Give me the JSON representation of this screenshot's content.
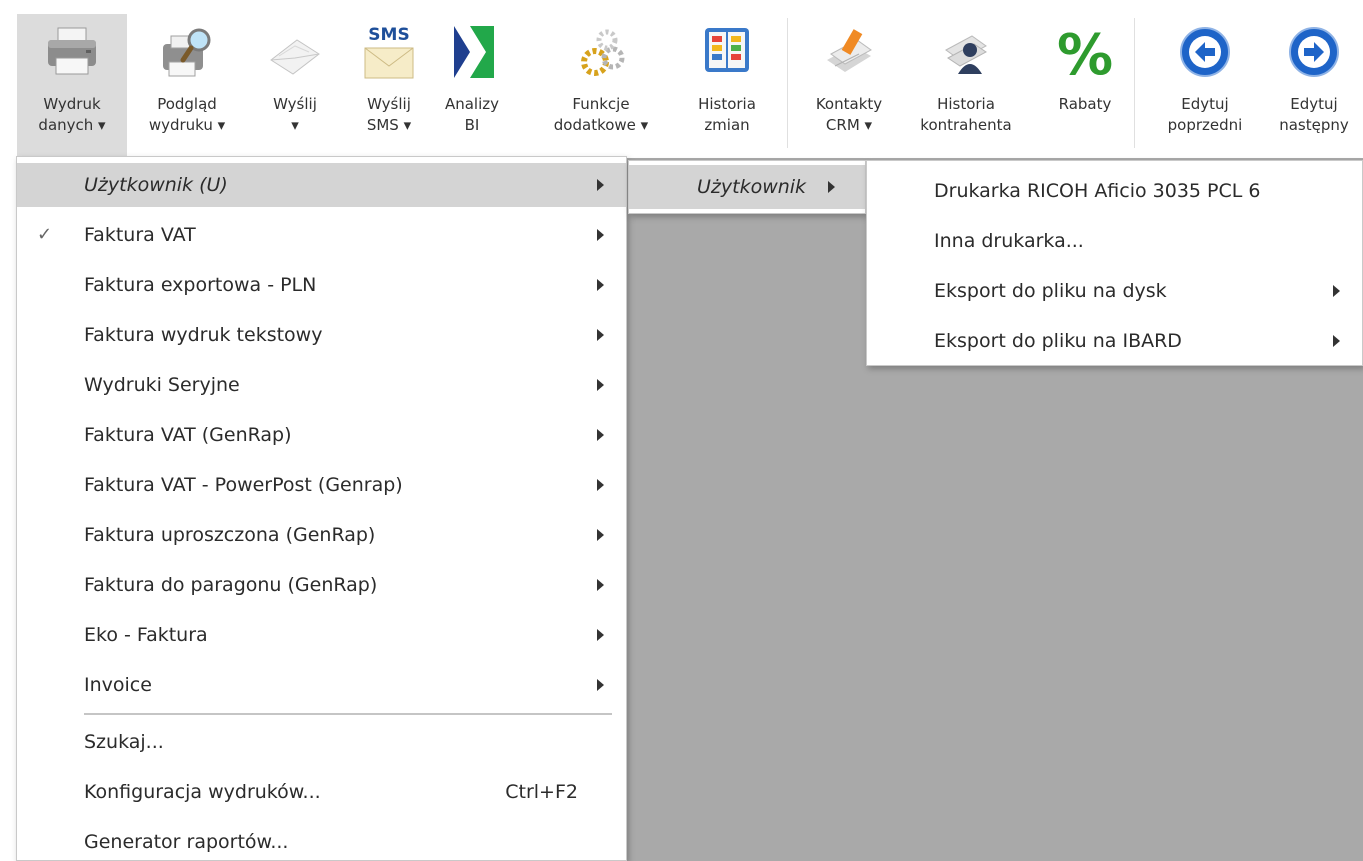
{
  "ribbon": {
    "buttons": [
      {
        "line1": "Wydruk",
        "line2": "danych ▾",
        "icon": "printer-icon"
      },
      {
        "line1": "Podgląd",
        "line2": "wydruku ▾",
        "icon": "print-preview-icon"
      },
      {
        "line1": "Wyślij",
        "line2": "▾",
        "icon": "send-envelope-icon"
      },
      {
        "line1": "Wyślij",
        "line2": "SMS ▾",
        "icon": "sms-icon",
        "icon_text": "SMS"
      },
      {
        "line1": "Analizy",
        "line2": "BI",
        "icon": "analytics-bi-icon"
      },
      {
        "line1": "Funkcje",
        "line2": "dodatkowe ▾",
        "icon": "gears-icon"
      },
      {
        "line1": "Historia",
        "line2": "zmian",
        "icon": "history-book-icon"
      },
      {
        "line1": "Kontakty",
        "line2": "CRM ▾",
        "icon": "crm-contacts-icon"
      },
      {
        "line1": "Historia",
        "line2": "kontrahenta",
        "icon": "contractor-history-icon"
      },
      {
        "line1": "Rabaty",
        "line2": "",
        "icon": "percent-icon",
        "icon_text": "%"
      },
      {
        "line1": "Edytuj",
        "line2": "poprzedni",
        "icon": "arrow-left-circle-icon"
      },
      {
        "line1": "Edytuj",
        "line2": "następny",
        "icon": "arrow-right-circle-icon"
      }
    ]
  },
  "menu_main": {
    "items": [
      {
        "label": "Użytkownik (U)",
        "submenu": true,
        "highlighted": true,
        "italic": true
      },
      {
        "label": "Faktura VAT",
        "submenu": true,
        "checked": true
      },
      {
        "label": "Faktura exportowa - PLN",
        "submenu": true
      },
      {
        "label": "Faktura wydruk tekstowy",
        "submenu": true
      },
      {
        "label": "Wydruki Seryjne",
        "submenu": true
      },
      {
        "label": "Faktura VAT (GenRap)",
        "submenu": true
      },
      {
        "label": "Faktura VAT - PowerPost (Genrap)",
        "submenu": true
      },
      {
        "label": "Faktura uproszczona (GenRap)",
        "submenu": true
      },
      {
        "label": "Faktura do paragonu (GenRap)",
        "submenu": true
      },
      {
        "label": "Eko - Faktura",
        "submenu": true
      },
      {
        "label": "Invoice",
        "submenu": true
      }
    ],
    "footer_items": [
      {
        "label": "Szukaj..."
      },
      {
        "label": "Konfiguracja wydruków...",
        "shortcut": "Ctrl+F2"
      },
      {
        "label": "Generator raportów..."
      }
    ],
    "check_glyph": "✓"
  },
  "menu_user": {
    "items": [
      {
        "label": "Użytkownik",
        "submenu": true,
        "highlighted": true,
        "italic": true
      }
    ]
  },
  "menu_printer": {
    "items": [
      {
        "label": "Drukarka RICOH Aficio 3035 PCL 6",
        "submenu": false
      },
      {
        "label": "Inna drukarka...",
        "submenu": false
      },
      {
        "label": "Eksport do pliku na dysk",
        "submenu": true
      },
      {
        "label": "Eksport do pliku na IBARD",
        "submenu": true
      }
    ]
  },
  "colors": {
    "content_bg": "#a9a9a9",
    "menu_highlight": "#d4d4d4",
    "ribbon_active": "#dcdcdc",
    "percent_green": "#2e9b2e",
    "nav_blue": "#1e64c8",
    "bi_blue": "#1f3f8f",
    "bi_green": "#22a84a"
  }
}
